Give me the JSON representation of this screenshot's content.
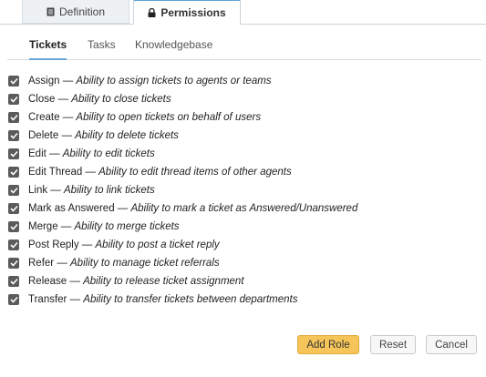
{
  "top_tabs": [
    {
      "label": "Definition",
      "icon": "document-icon",
      "active": false
    },
    {
      "label": "Permissions",
      "icon": "lock-icon",
      "active": true
    }
  ],
  "sub_tabs": [
    {
      "label": "Tickets",
      "active": true
    },
    {
      "label": "Tasks",
      "active": false
    },
    {
      "label": "Knowledgebase",
      "active": false
    }
  ],
  "permissions": [
    {
      "name": "Assign",
      "desc": "Ability to assign tickets to agents or teams",
      "checked": true
    },
    {
      "name": "Close",
      "desc": "Ability to close tickets",
      "checked": true
    },
    {
      "name": "Create",
      "desc": "Ability to open tickets on behalf of users",
      "checked": true
    },
    {
      "name": "Delete",
      "desc": "Ability to delete tickets",
      "checked": true
    },
    {
      "name": "Edit",
      "desc": "Ability to edit tickets",
      "checked": true
    },
    {
      "name": "Edit Thread",
      "desc": "Ability to edit thread items of other agents",
      "checked": true
    },
    {
      "name": "Link",
      "desc": "Ability to link tickets",
      "checked": true
    },
    {
      "name": "Mark as Answered",
      "desc": "Ability to mark a ticket as Answered/Unanswered",
      "checked": true
    },
    {
      "name": "Merge",
      "desc": "Ability to merge tickets",
      "checked": true
    },
    {
      "name": "Post Reply",
      "desc": "Ability to post a ticket reply",
      "checked": true
    },
    {
      "name": "Refer",
      "desc": "Ability to manage ticket referrals",
      "checked": true
    },
    {
      "name": "Release",
      "desc": "Ability to release ticket assignment",
      "checked": true
    },
    {
      "name": "Transfer",
      "desc": "Ability to transfer tickets between departments",
      "checked": true
    }
  ],
  "separator": " — ",
  "buttons": {
    "add_role": "Add Role",
    "reset": "Reset",
    "cancel": "Cancel"
  },
  "colors": {
    "primary_button": "#f6c55a",
    "active_tab_accent": "#5aa4d8",
    "checkbox_fill": "#5b5b5b"
  }
}
